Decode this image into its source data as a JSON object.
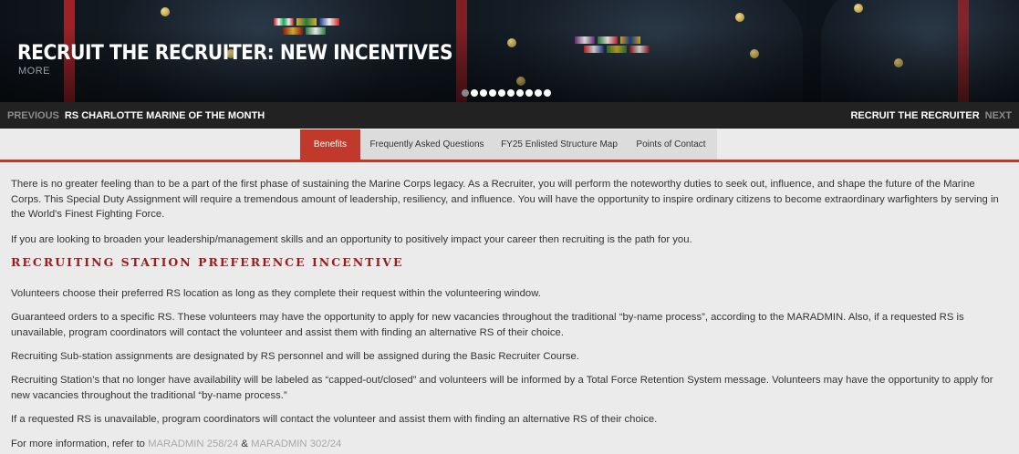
{
  "hero": {
    "title": "RECRUIT THE RECRUITER: NEW INCENTIVES",
    "more_label": "MORE",
    "slide_count": 10,
    "active_slide": 1
  },
  "pager": {
    "previous_label": "PREVIOUS",
    "previous_title": "RS CHARLOTTE MARINE OF THE MONTH",
    "next_title": "RECRUIT THE RECRUITER",
    "next_label": "NEXT"
  },
  "tabs": [
    {
      "label": "Benefits",
      "active": true
    },
    {
      "label": "Frequently Asked Questions",
      "active": false
    },
    {
      "label": "FY25 Enlisted Structure Map",
      "active": false
    },
    {
      "label": "Points of Contact",
      "active": false
    }
  ],
  "content": {
    "intro": "There is no greater feeling than to be a part of the first phase of sustaining the Marine Corps legacy. As a Recruiter, you will perform the noteworthy duties to seek out, influence, and shape the future of the Marine Corps.  This Special Duty Assignment will require a tremendous amount of leadership, resiliency, and influence. You will have the opportunity to inspire ordinary citizens to become extraordinary warfighters by serving in the World's Finest Fighting Force.",
    "broaden": "If you are looking to broaden your leadership/management skills and an opportunity to positively impact your career then recruiting is the path for you.",
    "section_heading": "RECRUITING STATION PREFERENCE INCENTIVE",
    "paragraphs": [
      "Volunteers choose their preferred RS location as long as they complete their request within the volunteering window.",
      "Guaranteed  orders to a specific RS. These volunteers may have the opportunity to apply for new vacancies throughout the traditional “by-name process”, according to the MARADMIN. Also, if a requested RS is unavailable, program coordinators will contact the volunteer and assist them with finding an alternative RS of their choice.",
      "Recruiting Sub-station assignments are designated by RS personnel and will be assigned during the Basic Recruiter Course.",
      "Recruiting Station’s that no longer have availability will be labeled as “capped-out/closed” and volunteers will be informed by a Total Force Retention System message. Volunteers may have the opportunity to apply for new vacancies throughout the traditional “by-name process.”",
      "If a requested RS is unavailable, program coordinators will contact the volunteer and assist them with finding an alternative RS of their choice."
    ],
    "more_info_prefix": "For more information, refer to ",
    "link1": "MARADMIN 258/24",
    "link_joiner": " & ",
    "link2": "MARADMIN 302/24"
  },
  "colors": {
    "accent": "#c0392b",
    "heading_red": "#9b1c1c",
    "dark_bar": "#222222",
    "page_bg": "#ebebeb"
  }
}
